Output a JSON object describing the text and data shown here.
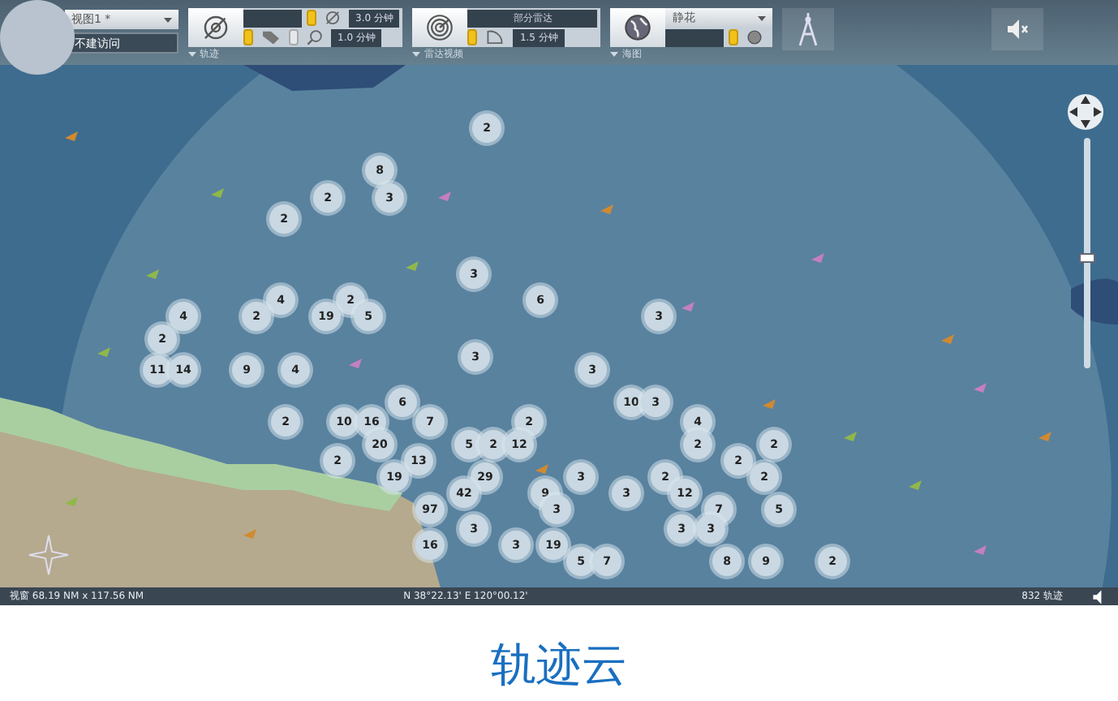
{
  "view_select": {
    "value": "视图1 *"
  },
  "access_field": {
    "value": "不建访问"
  },
  "track": {
    "label": "轨迹",
    "tag_toggle": {
      "on": true
    },
    "history": {
      "on": true,
      "reading": "3.0 分钟"
    },
    "search": {
      "on": false,
      "reading": "1.0 分钟"
    }
  },
  "radar": {
    "label": "雷达视频",
    "select": "部分雷达",
    "sweep": {
      "on": true,
      "reading": "1.5 分钟"
    }
  },
  "chart_layer": {
    "label": "海图",
    "select": "静花",
    "layer": {
      "on": true
    }
  },
  "map": {
    "clusters": [
      "2",
      "8",
      "2",
      "3",
      "2",
      "3",
      "4",
      "2",
      "6",
      "4",
      "2",
      "19",
      "5",
      "3",
      "2",
      "3",
      "11",
      "14",
      "9",
      "4",
      "3",
      "6",
      "10",
      "3",
      "2",
      "10",
      "16",
      "7",
      "2",
      "4",
      "20",
      "5",
      "2",
      "12",
      "2",
      "2",
      "2",
      "13",
      "2",
      "19",
      "29",
      "3",
      "2",
      "2",
      "42",
      "9",
      "3",
      "12",
      "97",
      "3",
      "7",
      "5",
      "3",
      "3",
      "3",
      "16",
      "3",
      "19",
      "5",
      "7",
      "8",
      "9",
      "2"
    ],
    "zoom_slider": {
      "level": 0.52
    }
  },
  "status_bar": {
    "view_size": "视窗 68.19 NM x 117.56 NM",
    "position": "N 38°22.13' E 120°00.12'",
    "track_count": "832 轨迹"
  },
  "caption": "轨迹云"
}
